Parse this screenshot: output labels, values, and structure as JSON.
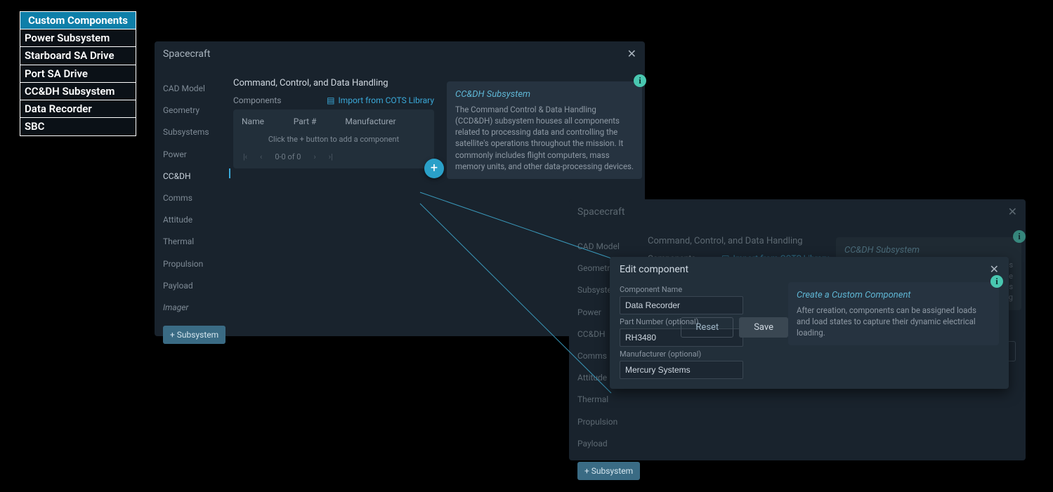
{
  "comp_list": {
    "header": "Custom Components",
    "items": [
      "Power Subsystem",
      "Starboard SA Drive",
      "Port SA Drive",
      "CC&DH Subsystem",
      "Data Recorder",
      "SBC"
    ]
  },
  "panel1": {
    "title": "Spacecraft",
    "section": "Command, Control, and Data Handling",
    "components_label": "Components",
    "import_label": "Import from COTS Library",
    "columns": {
      "name": "Name",
      "part": "Part #",
      "man": "Manufacturer"
    },
    "empty_msg": "Click the + button to add a component",
    "pager": "0-0 of 0",
    "close": "Close",
    "callout": {
      "title": "CC&DH Subsystem",
      "body": "The Command Control & Data Handling (CCD&DH) subsystem houses all components related to processing data and controlling the satellite's operations throughout the mission. It commonly includes flight computers, mass memory units, and other data-processing devices."
    },
    "nav": [
      "CAD Model",
      "Geometry",
      "Subsystems",
      "Power",
      "CC&DH",
      "Comms",
      "Attitude",
      "Thermal",
      "Propulsion",
      "Payload",
      "Imager"
    ],
    "add_sub": "+ Subsystem"
  },
  "panel2": {
    "title": "Spacecraft",
    "section": "Command, Control, and Data Handling",
    "components_label": "Components",
    "import_label": "Import from COTS Library",
    "chip": "CC&DH Subsystem",
    "close": "Close",
    "nav": [
      "CAD Model",
      "Geometry",
      "Subsystems",
      "Power",
      "CC&DH",
      "Comms",
      "Attitude",
      "Thermal",
      "Propulsion",
      "Payload"
    ],
    "add_sub": "+ Subsystem",
    "truncated_lines": [
      "em houses",
      "the",
      "includes",
      "essing"
    ]
  },
  "modal": {
    "title": "Edit component",
    "name_label": "Component Name",
    "name_value": "Data Recorder",
    "part_label": "Part Number (optional)",
    "part_value": "RH3480",
    "man_label": "Manufacturer (optional)",
    "man_value": "Mercury Systems",
    "reset": "Reset",
    "save": "Save",
    "callout": {
      "title": "Create a Custom Component",
      "body": "After creation, components can be assigned loads and load states to capture their dynamic electrical loading."
    }
  }
}
